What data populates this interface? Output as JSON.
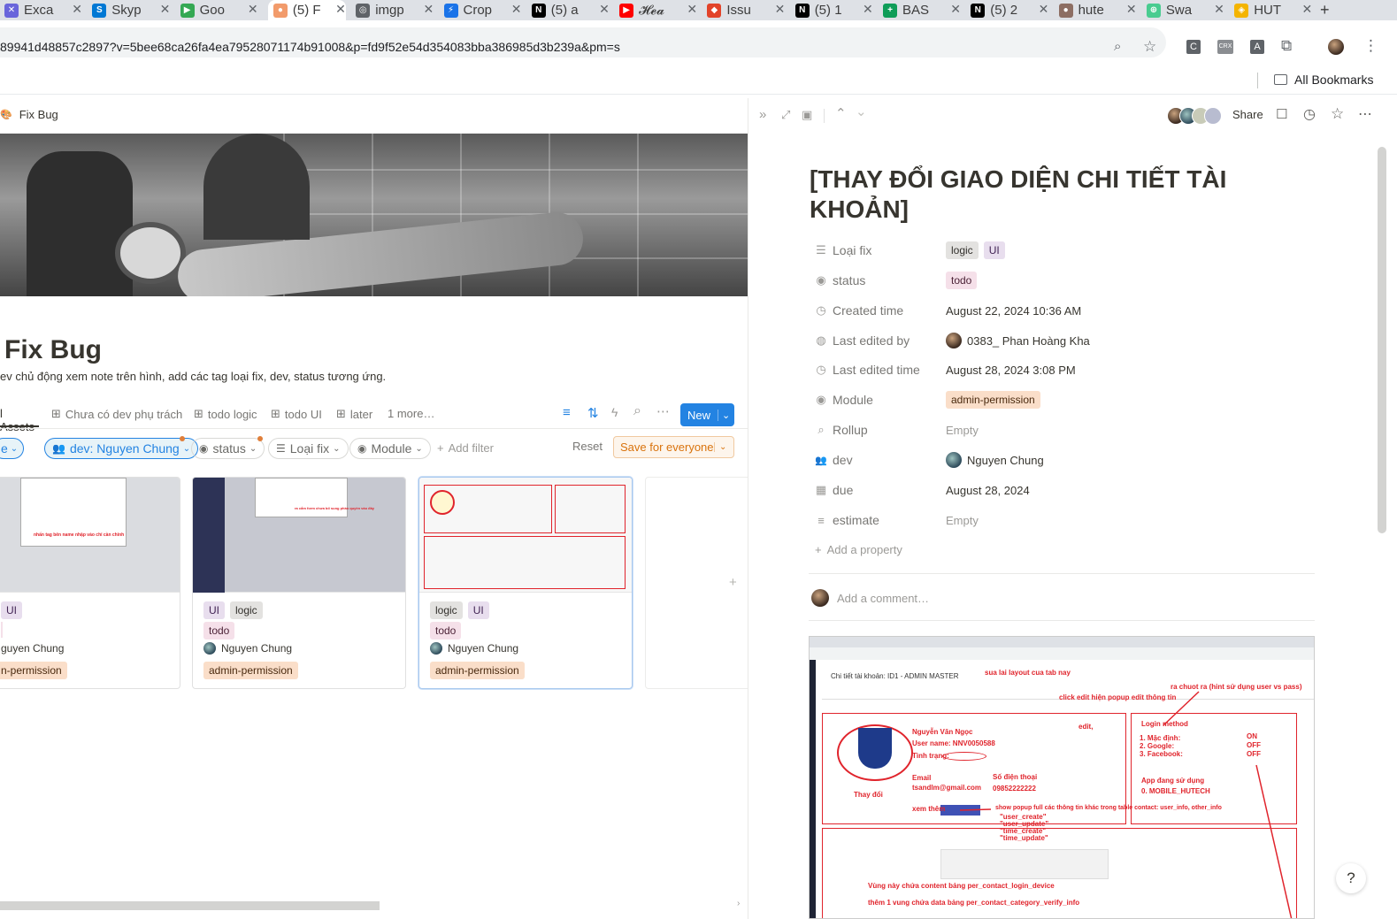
{
  "browser": {
    "tabs": [
      {
        "label": "Exca",
        "color": "#6965db",
        "glyph": "✕"
      },
      {
        "label": "Skyp",
        "color": "#0078d4",
        "glyph": "S"
      },
      {
        "label": "Goo",
        "color": "#34a853",
        "glyph": "▶"
      },
      {
        "label": "(5) F",
        "color": "#f29b6b",
        "glyph": "●",
        "active": true
      },
      {
        "label": "imgp",
        "color": "#5f6368",
        "glyph": "◎"
      },
      {
        "label": "Crop",
        "color": "#1a73e8",
        "glyph": "⚡"
      },
      {
        "label": "(5) a",
        "color": "#000000",
        "glyph": "N"
      },
      {
        "label": "𝓗𝓮𝓪",
        "color": "#ff0000",
        "glyph": "▶"
      },
      {
        "label": "Issu",
        "color": "#e24329",
        "glyph": "◆"
      },
      {
        "label": "(5) 1",
        "color": "#000000",
        "glyph": "N"
      },
      {
        "label": "BAS",
        "color": "#0f9d58",
        "glyph": "+"
      },
      {
        "label": "(5) 2",
        "color": "#000000",
        "glyph": "N"
      },
      {
        "label": "hute",
        "color": "#8d6e63",
        "glyph": "●"
      },
      {
        "label": "Swa",
        "color": "#49cc90",
        "glyph": "⊕"
      },
      {
        "label": "HUT",
        "color": "#f4b400",
        "glyph": "◈"
      }
    ],
    "new_tab": "+",
    "url": "89941d48857c2897?v=5bee68ca26fa4ea79528071174b91008&p=fd9f52e54d354083bba386985d3b239a&pm=s",
    "all_bookmarks": "All Bookmarks"
  },
  "left": {
    "breadcrumb": "Fix Bug",
    "page_title": "Fix Bug",
    "description": "ev chủ động xem note trên hình, add các tag loại fix, dev, status tương ứng.",
    "views": [
      "l Assets",
      "Chưa có dev phụ trách",
      "todo logic",
      "todo UI",
      "later",
      "1 more…"
    ],
    "new_button": "New",
    "filters": {
      "first": "e",
      "dev": "dev: Nguyen Chung",
      "status": "status",
      "loai_fix": "Loại fix",
      "module": "Module",
      "add_filter": "Add filter",
      "reset": "Reset",
      "save": "Save for everyone"
    },
    "cards": [
      {
        "tags": [
          "",
          "UI"
        ],
        "status": "",
        "dev": "guyen Chung",
        "module": "n-permission"
      },
      {
        "tags": [
          "UI",
          "logic"
        ],
        "status": "todo",
        "dev": "Nguyen Chung",
        "module": "admin-permission"
      },
      {
        "tags": [
          "logic",
          "UI"
        ],
        "status": "todo",
        "dev": "Nguyen Chung",
        "module": "admin-permission"
      }
    ]
  },
  "right": {
    "share": "Share",
    "title": "[THAY ĐỔI GIAO DIỆN CHI TIẾT TÀI KHOẢN]",
    "properties": [
      {
        "icon": "list-icon",
        "glyph": "☰",
        "label": "Loại fix"
      },
      {
        "icon": "status-icon",
        "glyph": "◉",
        "label": "status"
      },
      {
        "icon": "clock-icon",
        "glyph": "◷",
        "label": "Created time"
      },
      {
        "icon": "user-icon",
        "glyph": "◍",
        "label": "Last edited by"
      },
      {
        "icon": "clock-icon",
        "glyph": "◷",
        "label": "Last edited time"
      },
      {
        "icon": "module-icon",
        "glyph": "◉",
        "label": "Module"
      },
      {
        "icon": "search-icon",
        "glyph": "⌕",
        "label": "Rollup"
      },
      {
        "icon": "people-icon",
        "glyph": "👥",
        "label": "dev"
      },
      {
        "icon": "calendar-icon",
        "glyph": "▦",
        "label": "due"
      },
      {
        "icon": "text-icon",
        "glyph": "≡",
        "label": "estimate"
      }
    ],
    "values": {
      "loai_fix": [
        "logic",
        "UI"
      ],
      "status": "todo",
      "created_time": "August 22, 2024 10:36 AM",
      "last_edited_by": "0383_ Phan Hoàng Kha",
      "last_edited_time": "August 28, 2024 3:08 PM",
      "module": "admin-permission",
      "rollup": "Empty",
      "dev": "Nguyen Chung",
      "due": "August 28, 2024",
      "estimate": "Empty"
    },
    "add_property": "Add a property",
    "comment_placeholder": "Add a comment…",
    "screenshot": {
      "header": "Chi tiết tài khoản: ID1 - ADMIN MASTER",
      "notes": [
        "sua lai layout cua tab nay",
        "ra chuot ra  (hint sử dụng user vs pass)",
        "click edit hiện popup edit thông tin",
        "edit,",
        "Nguyễn Văn Ngọc",
        "User name: NNV0050588",
        "Tình trạng:",
        "Email",
        "tsandlm@gmail.com",
        "Số điện thoại",
        "09852222222",
        "Thay đổi",
        "xem thêm",
        "show popup full các thông tin khác trong table contact: user_info, other_info",
        "\"user_create\"",
        "\"user_update\"",
        "\"time_create\"",
        "\"time_update\"",
        "Login method",
        "1. Mặc định:",
        "2. Google:",
        "3. Facebook:",
        "ON",
        "OFF",
        "OFF",
        "App đang sử dụng",
        "0. MOBILE_HUTECH",
        "Vùng này chứa content bảng per_contact_login_device",
        "thêm 1 vung chứa data bảng per_contact_category_verify_info"
      ]
    },
    "help": "?"
  }
}
